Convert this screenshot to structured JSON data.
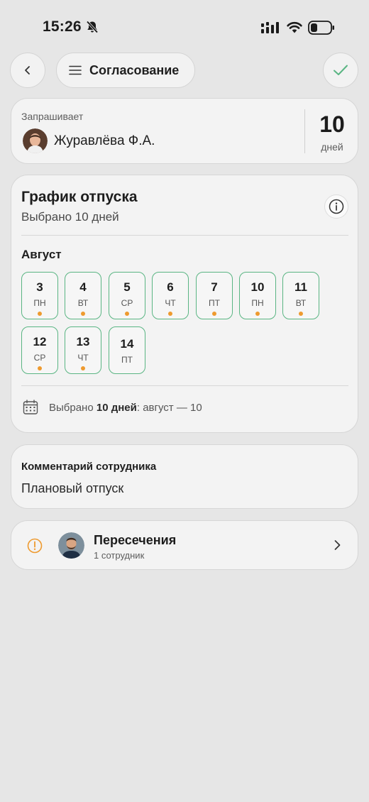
{
  "status_bar": {
    "time": "15:26"
  },
  "nav": {
    "title": "Согласование"
  },
  "requester": {
    "label": "Запрашивает",
    "name": "Журавлёва Ф.А.",
    "days_count": "10",
    "days_unit": "дней"
  },
  "schedule": {
    "title": "График отпуска",
    "subtitle": "Выбрано 10 дней",
    "month": "Август",
    "days": [
      {
        "num": "3",
        "weekday": "ПН",
        "marked": true
      },
      {
        "num": "4",
        "weekday": "ВТ",
        "marked": true
      },
      {
        "num": "5",
        "weekday": "СР",
        "marked": true
      },
      {
        "num": "6",
        "weekday": "ЧТ",
        "marked": true
      },
      {
        "num": "7",
        "weekday": "ПТ",
        "marked": true
      },
      {
        "num": "10",
        "weekday": "ПН",
        "marked": true
      },
      {
        "num": "11",
        "weekday": "ВТ",
        "marked": true
      },
      {
        "num": "12",
        "weekday": "СР",
        "marked": true
      },
      {
        "num": "13",
        "weekday": "ЧТ",
        "marked": true
      },
      {
        "num": "14",
        "weekday": "ПТ",
        "marked": false
      }
    ],
    "summary_prefix": "Выбрано ",
    "summary_bold": "10 дней",
    "summary_suffix": ": август — 10"
  },
  "comment": {
    "title": "Комментарий сотрудника",
    "text": "Плановый отпуск"
  },
  "overlaps": {
    "title": "Пересечения",
    "subtitle": "1 сотрудник"
  },
  "colors": {
    "chip_border": "#5ab583",
    "marker_dot": "#ee9a2f",
    "confirm_check": "#5ab583",
    "warning": "#ee9a2f"
  },
  "icons": [
    "bell-off-icon",
    "signal-icon",
    "wifi-icon",
    "battery-icon",
    "back-arrow-icon",
    "menu-icon",
    "check-icon",
    "info-icon",
    "calendar-icon",
    "warning-icon",
    "chevron-right-icon"
  ]
}
